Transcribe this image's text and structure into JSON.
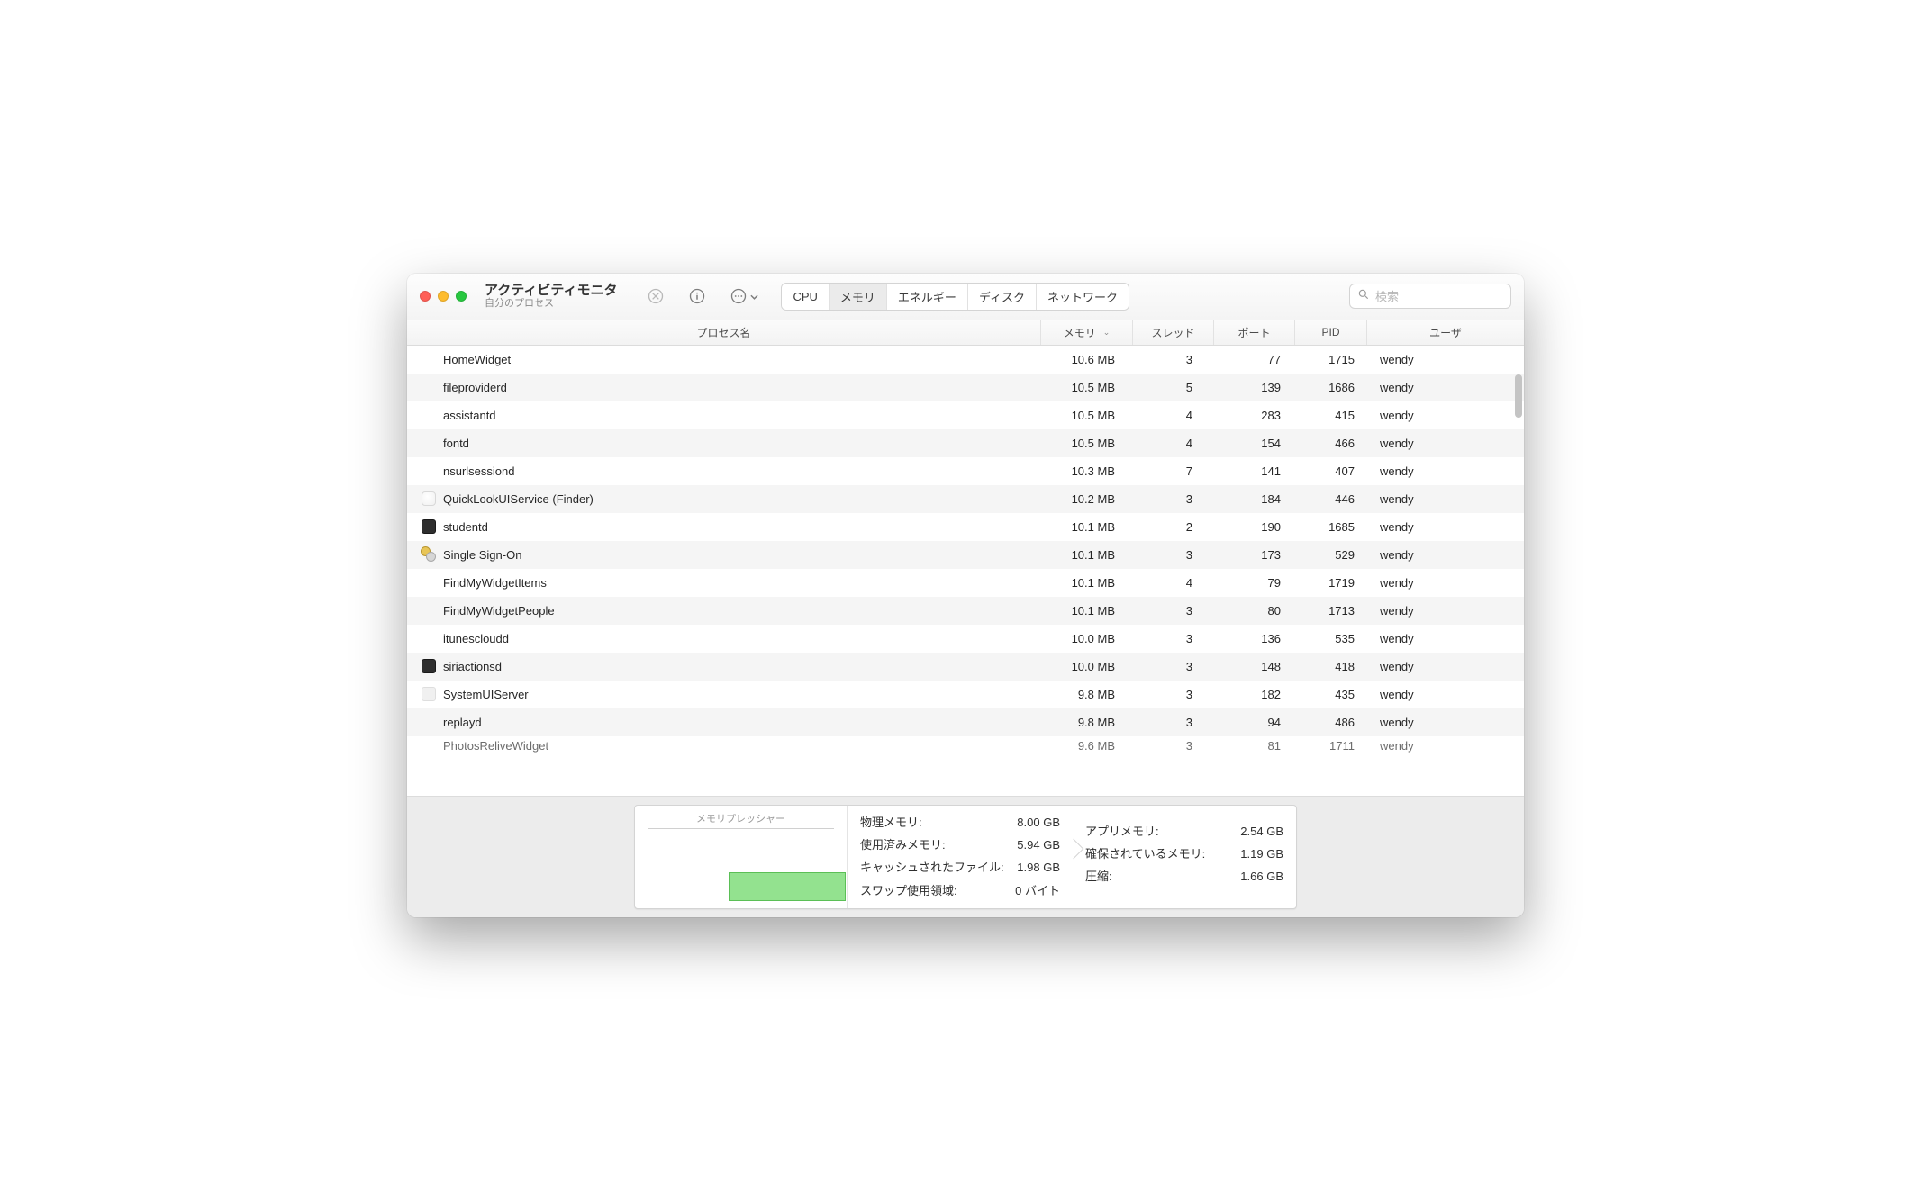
{
  "window": {
    "title": "アクティビティモニタ",
    "subtitle": "自分のプロセス"
  },
  "tabs": {
    "cpu": "CPU",
    "memory": "メモリ",
    "energy": "エネルギー",
    "disk": "ディスク",
    "network": "ネットワーク"
  },
  "search": {
    "placeholder": "検索"
  },
  "columns": {
    "name": "プロセス名",
    "memory": "メモリ",
    "threads": "スレッド",
    "ports": "ポート",
    "pid": "PID",
    "user": "ユーザ"
  },
  "processes": [
    {
      "icon": "",
      "name": "HomeWidget",
      "memory": "10.6 MB",
      "threads": "3",
      "ports": "77",
      "pid": "1715",
      "user": "wendy"
    },
    {
      "icon": "",
      "name": "fileproviderd",
      "memory": "10.5 MB",
      "threads": "5",
      "ports": "139",
      "pid": "1686",
      "user": "wendy"
    },
    {
      "icon": "",
      "name": "assistantd",
      "memory": "10.5 MB",
      "threads": "4",
      "ports": "283",
      "pid": "415",
      "user": "wendy"
    },
    {
      "icon": "",
      "name": "fontd",
      "memory": "10.5 MB",
      "threads": "4",
      "ports": "154",
      "pid": "466",
      "user": "wendy"
    },
    {
      "icon": "",
      "name": "nsurlsessiond",
      "memory": "10.3 MB",
      "threads": "7",
      "ports": "141",
      "pid": "407",
      "user": "wendy"
    },
    {
      "icon": "shield",
      "name": "QuickLookUIService (Finder)",
      "memory": "10.2 MB",
      "threads": "3",
      "ports": "184",
      "pid": "446",
      "user": "wendy"
    },
    {
      "icon": "terminal",
      "name": "studentd",
      "memory": "10.1 MB",
      "threads": "2",
      "ports": "190",
      "pid": "1685",
      "user": "wendy"
    },
    {
      "icon": "keys",
      "name": "Single Sign-On",
      "memory": "10.1 MB",
      "threads": "3",
      "ports": "173",
      "pid": "529",
      "user": "wendy"
    },
    {
      "icon": "",
      "name": "FindMyWidgetItems",
      "memory": "10.1 MB",
      "threads": "4",
      "ports": "79",
      "pid": "1719",
      "user": "wendy"
    },
    {
      "icon": "",
      "name": "FindMyWidgetPeople",
      "memory": "10.1 MB",
      "threads": "3",
      "ports": "80",
      "pid": "1713",
      "user": "wendy"
    },
    {
      "icon": "",
      "name": "itunescloudd",
      "memory": "10.0 MB",
      "threads": "3",
      "ports": "136",
      "pid": "535",
      "user": "wendy"
    },
    {
      "icon": "terminal",
      "name": "siriactionsd",
      "memory": "10.0 MB",
      "threads": "3",
      "ports": "148",
      "pid": "418",
      "user": "wendy"
    },
    {
      "icon": "blank",
      "name": "SystemUIServer",
      "memory": "9.8 MB",
      "threads": "3",
      "ports": "182",
      "pid": "435",
      "user": "wendy"
    },
    {
      "icon": "",
      "name": "replayd",
      "memory": "9.8 MB",
      "threads": "3",
      "ports": "94",
      "pid": "486",
      "user": "wendy"
    },
    {
      "icon": "",
      "name": "PhotosReliveWidget",
      "memory": "9.6 MB",
      "threads": "3",
      "ports": "81",
      "pid": "1711",
      "user": "wendy"
    }
  ],
  "footer": {
    "pressure_label": "メモリプレッシャー",
    "mid": {
      "physical_k": "物理メモリ:",
      "physical_v": "8.00 GB",
      "used_k": "使用済みメモリ:",
      "used_v": "5.94 GB",
      "cached_k": "キャッシュされたファイル:",
      "cached_v": "1.98 GB",
      "swap_k": "スワップ使用領域:",
      "swap_v": "0 バイト"
    },
    "right": {
      "app_k": "アプリメモリ:",
      "app_v": "2.54 GB",
      "wired_k": "確保されているメモリ:",
      "wired_v": "1.19 GB",
      "comp_k": "圧縮:",
      "comp_v": "1.66 GB"
    }
  },
  "chart_data": {
    "type": "area",
    "title": "メモリプレッシャー",
    "xlabel": "",
    "ylabel": "",
    "ylim": [
      0,
      100
    ],
    "series": [
      {
        "name": "pressure",
        "color": "#93e28f",
        "values": [
          0,
          0,
          0,
          0,
          0,
          0,
          0,
          28,
          28,
          28,
          28,
          28,
          28,
          28,
          28
        ]
      }
    ]
  }
}
